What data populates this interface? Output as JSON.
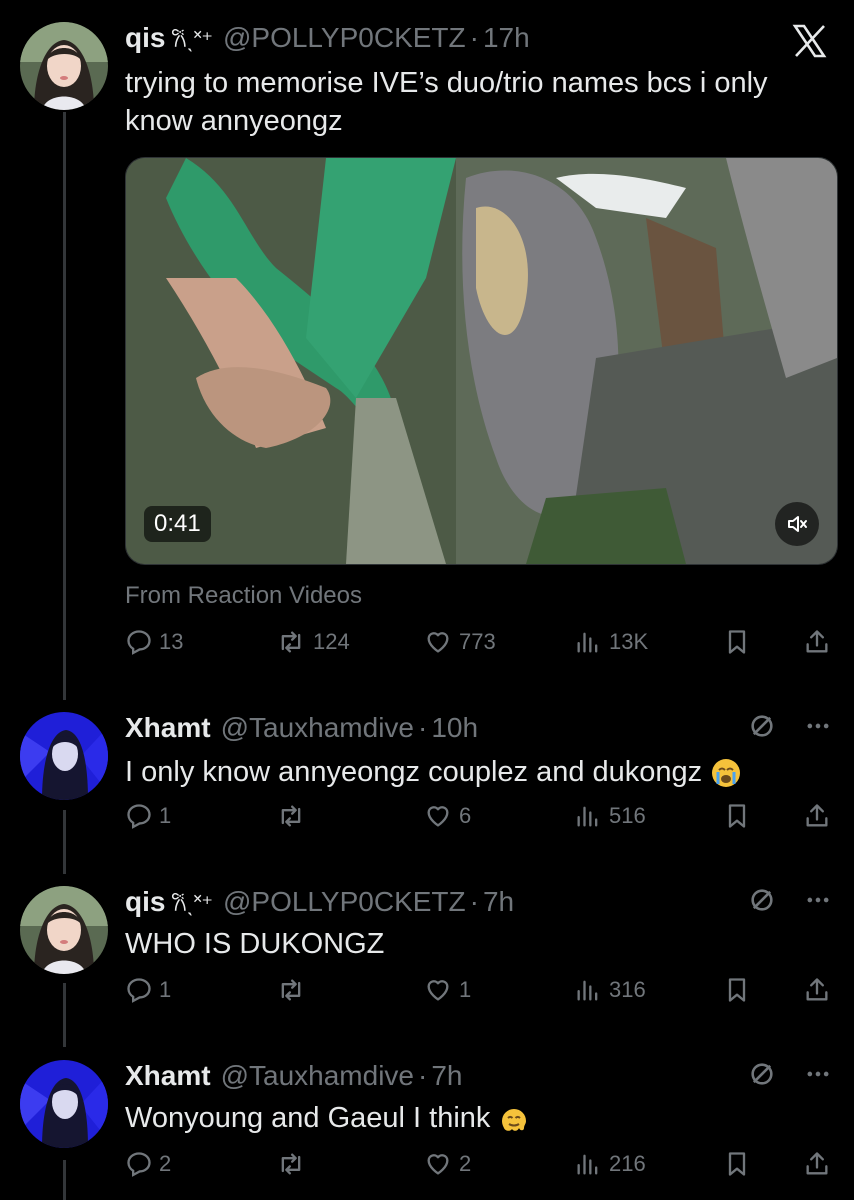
{
  "tweets": [
    {
      "name": "qis",
      "deco": "𐙚ˎ˟⁺",
      "handle": "@POLLYP0CKETZ",
      "time": "17h",
      "text": "trying to memorise IVE’s duo/trio names bcs i only know annyeongz",
      "video_duration": "0:41",
      "source": "From Reaction Videos",
      "replies": "13",
      "retweets": "124",
      "likes": "773",
      "views": "13K"
    },
    {
      "name": "Xhamt",
      "handle": "@Tauxhamdive",
      "time": "10h",
      "text": "I only know annyeongz couplez and dukongz",
      "emoji": "loudly-crying-face",
      "replies": "1",
      "retweets": "",
      "likes": "6",
      "views": "516"
    },
    {
      "name": "qis",
      "deco": "𐙚ˎ˟⁺",
      "handle": "@POLLYP0CKETZ",
      "time": "7h",
      "text": "WHO IS DUKONGZ",
      "replies": "1",
      "retweets": "",
      "likes": "1",
      "views": "316"
    },
    {
      "name": "Xhamt",
      "handle": "@Tauxhamdive",
      "time": "7h",
      "text": "Wonyoung and Gaeul I think",
      "emoji": "melting-face",
      "replies": "2",
      "retweets": "",
      "likes": "2",
      "views": "216"
    }
  ],
  "colors": {
    "background": "#000000",
    "text": "#e7e9ea",
    "muted": "#71767b",
    "line": "#333639"
  },
  "icons": [
    "x-logo-icon",
    "reply-icon",
    "retweet-icon",
    "like-icon",
    "views-icon",
    "bookmark-icon",
    "share-icon",
    "grok-icon",
    "more-icon",
    "muted-icon"
  ]
}
